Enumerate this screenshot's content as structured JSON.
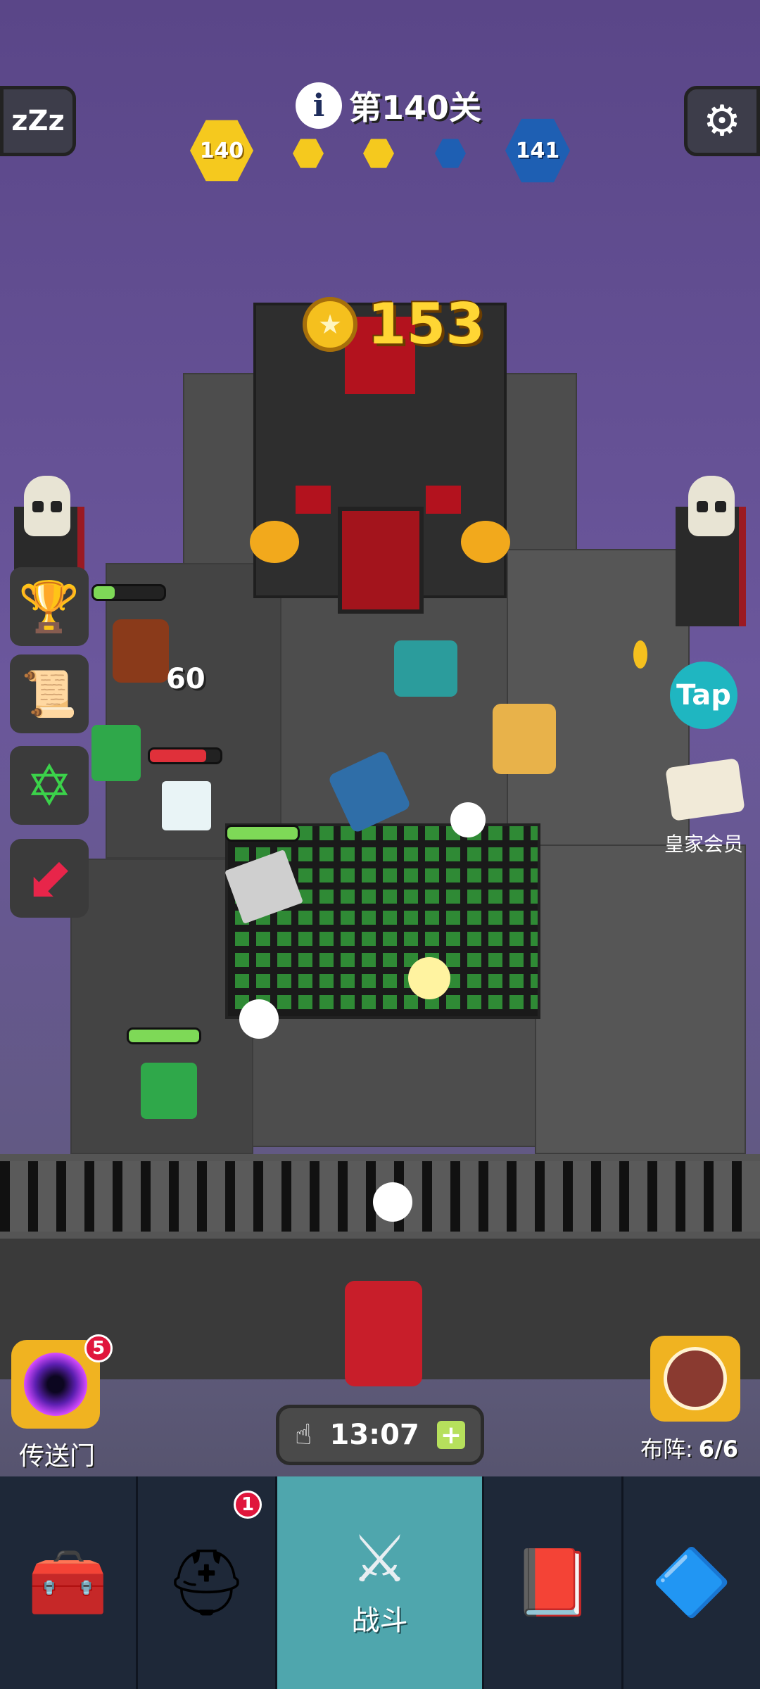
{
  "hud": {
    "sleep_label": "zZz",
    "level_info_icon": "info-icon",
    "level_text": "第140关",
    "current_level": "140",
    "next_level": "141",
    "stage_progress": {
      "completed": 2,
      "total": 3
    },
    "coins": "153"
  },
  "battle": {
    "damage_text": "60",
    "tap_label": "Tap",
    "vip_label": "皇家会员"
  },
  "side_buttons": [
    {
      "icon": "leaderboard-icon"
    },
    {
      "icon": "scroll-icon"
    },
    {
      "icon": "hexagram-icon"
    },
    {
      "icon": "arrow-icon"
    }
  ],
  "portal": {
    "label": "传送门",
    "badge": "5"
  },
  "formation": {
    "label": "布阵:",
    "value": "6/6"
  },
  "timer": {
    "value": "13:07",
    "plus": "+"
  },
  "nav": {
    "items": [
      {
        "icon": "treasure-chest-icon",
        "label": ""
      },
      {
        "icon": "viking-helmet-icon",
        "label": "",
        "badge": "1"
      },
      {
        "icon": "crossed-swords-icon",
        "label": "战斗"
      },
      {
        "icon": "spellbook-icon",
        "label": ""
      },
      {
        "icon": "amulet-icon",
        "label": ""
      }
    ]
  },
  "colors": {
    "gold": "#ffd634",
    "green_hp": "#7ed957",
    "red_hp": "#e0303a",
    "nav_active": "#4fa6ad"
  }
}
